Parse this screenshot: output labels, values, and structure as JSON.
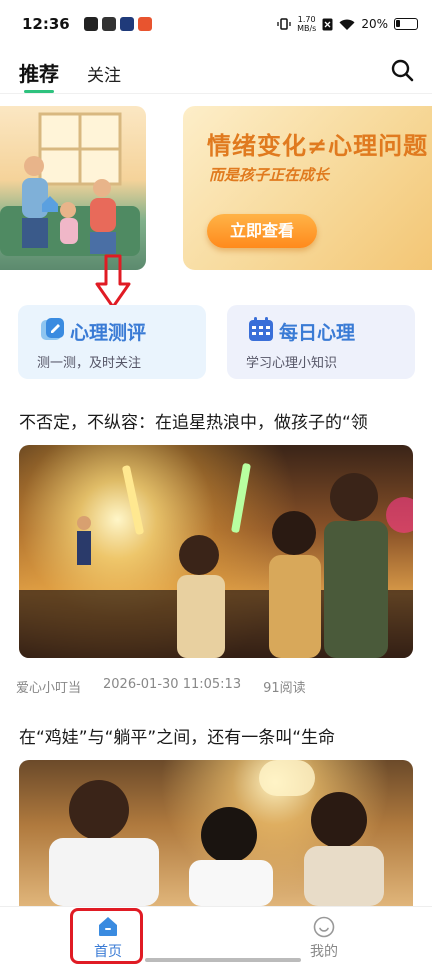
{
  "status_bar": {
    "time": "12:36",
    "speed_top": "1.70",
    "speed_unit": "MB/s",
    "battery": "20%"
  },
  "header": {
    "tab_recommend": "推荐",
    "tab_follow": "关注",
    "search_icon": "search-icon"
  },
  "banner": {
    "title": "情绪变化≠心理问题",
    "subtitle": "而是孩子正在成长",
    "button": "立即查看"
  },
  "cards": {
    "test_title": "心理测评",
    "test_sub": "测一测，及时关注",
    "daily_title": "每日心理",
    "daily_sub": "学习心理小知识"
  },
  "articles": [
    {
      "title": "不否定，不纵容：在追星热浪中，做孩子的“领",
      "author": "爱心小叮当",
      "date": "2026-01-30 11:05:13",
      "reads": "91阅读"
    },
    {
      "title": "在“鸡娃”与“躺平”之间，还有一条叫“生命"
    }
  ],
  "bottom_nav": {
    "home": "首页",
    "me": "我的"
  },
  "colors": {
    "accent_green": "#2ec27e",
    "accent_blue": "#3a7bd5",
    "banner_orange": "#e07a1f",
    "highlight_red": "#e01b24"
  }
}
